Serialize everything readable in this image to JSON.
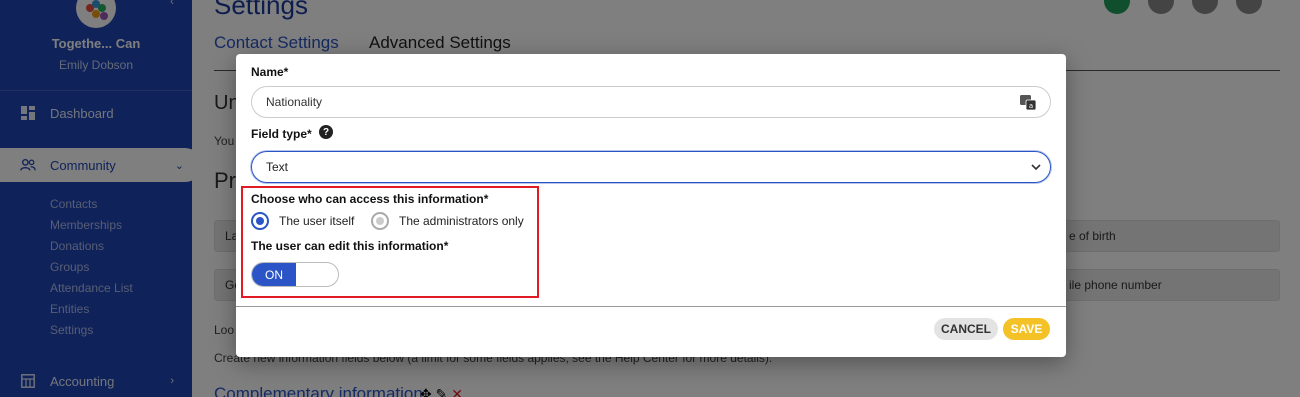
{
  "sidebar": {
    "org_name": "Togethe... Can",
    "user_name": "Emily Dobson",
    "items": [
      {
        "label": "Dashboard",
        "icon": "dashboard-icon"
      },
      {
        "label": "Community",
        "icon": "community-icon"
      },
      {
        "label": "Accounting",
        "icon": "accounting-icon"
      }
    ],
    "community_sub": [
      "Contacts",
      "Memberships",
      "Donations",
      "Groups",
      "Attendance List",
      "Entities",
      "Settings"
    ]
  },
  "main": {
    "title": "Settings",
    "tabs": [
      "Contact Settings",
      "Advanced Settings"
    ],
    "section_un": "Un",
    "you_text": "You",
    "section_pr": "Pr",
    "box_la": "La",
    "box_ge": "Ge",
    "box_dob": "e of birth",
    "box_phone": "ile phone number",
    "look_text": "Loo",
    "create_text": "Create new information fields below (a limit for some fields applies, see the Help Center for more details).",
    "comp_title": "Complementary information"
  },
  "dialog": {
    "name_label": "Name*",
    "name_value": "Nationality",
    "field_type_label": "Field type*",
    "field_type_value": "Text",
    "access_label": "Choose who can access this information*",
    "access_options": [
      {
        "label": "The user itself",
        "selected": true
      },
      {
        "label": "The administrators only",
        "selected": false
      }
    ],
    "edit_label": "The user can edit this information*",
    "toggle_state": "ON",
    "cancel_label": "CANCEL",
    "save_label": "SAVE"
  },
  "colors": {
    "primary": "#2b55c6",
    "sidebar": "#1f44b5",
    "save": "#f4c126",
    "highlight": "#e01b24"
  }
}
